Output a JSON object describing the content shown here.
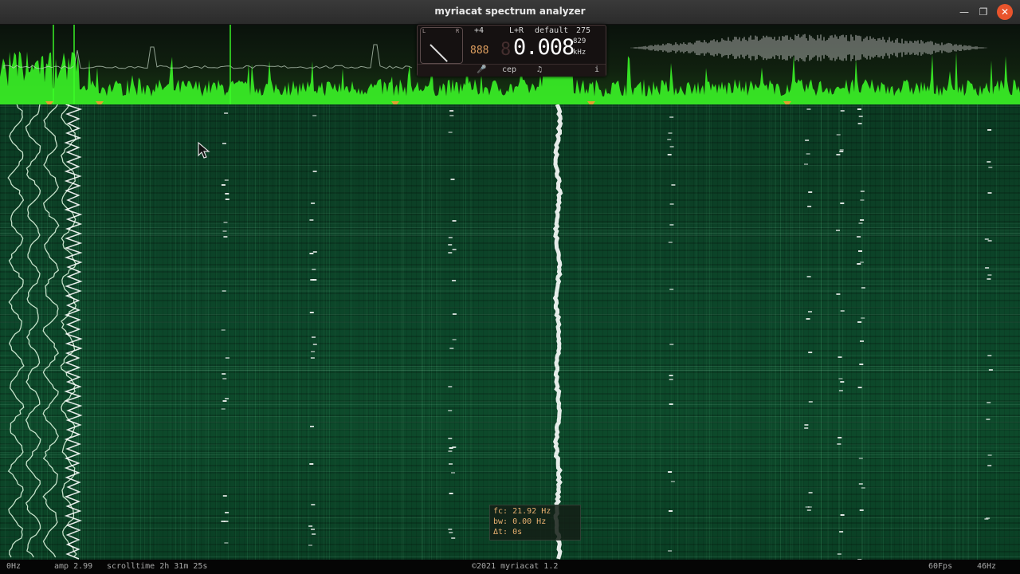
{
  "window": {
    "title": "myriacat spectrum analyzer",
    "minimize_icon": "minimize-icon",
    "maximize_icon": "maximize-icon",
    "close_icon": "close-icon",
    "min_glyph": "—",
    "max_glyph": "❐",
    "close_glyph": "✕"
  },
  "display": {
    "channel_gain": "+4",
    "channel_mode": "L+R",
    "preset": "default",
    "preset_value": "275",
    "counter": "888",
    "frequency": "0.008",
    "sub_value": "829",
    "unit": "kHz",
    "dial_left_label": "L",
    "dial_right_label": "R",
    "buttons": {
      "mic": "🎤",
      "cep": "cep",
      "note": "♫",
      "info": "i"
    }
  },
  "tooltip": {
    "fc": "fc: 21.92 Hz",
    "bw": "bw: 0.00 Hz",
    "dt": "Δt: 0s"
  },
  "status": {
    "freq_min": "0Hz",
    "amp": "amp 2.99",
    "scrolltime": "scrolltime 2h 31m 25s",
    "copyright": "©2021 myriacat 1.2",
    "fps": "60Fps",
    "freq_max": "46Hz"
  },
  "colors": {
    "spectrum_green": "#3cff28",
    "waterfall_bg": "#0c4529",
    "trace": "#e8ffe8",
    "marker": "#e0a030"
  },
  "markers_hz": [
    2.2,
    4.0,
    16.0,
    23.8,
    31.7
  ]
}
